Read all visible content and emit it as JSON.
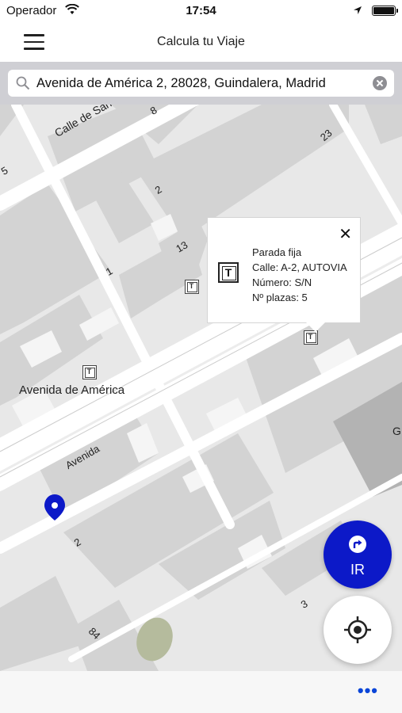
{
  "status_bar": {
    "carrier": "Operador",
    "time": "17:54"
  },
  "nav": {
    "title": "Calcula tu Viaje"
  },
  "search": {
    "value": "Avenida de América 2, 28028, Guindalera, Madrid"
  },
  "map": {
    "street_labels": [
      "Calle de San F",
      "Avenida de América",
      "Avenida"
    ],
    "number_labels": [
      "5",
      "8",
      "23",
      "2",
      "13",
      "1",
      "2",
      "3",
      "84",
      "G"
    ],
    "taxi_marker_letter": "T"
  },
  "popup": {
    "line1": "Parada fija",
    "line2": "Calle: A-2, AUTOVIA",
    "line3": "Número: S/N",
    "line4": "Nº plazas: 5",
    "close_label": "✕"
  },
  "actions": {
    "go_label": "IR",
    "more_label": "•••"
  },
  "colors": {
    "accent": "#0c19c8",
    "pin": "#0c19c8",
    "more": "#0a45d8"
  }
}
